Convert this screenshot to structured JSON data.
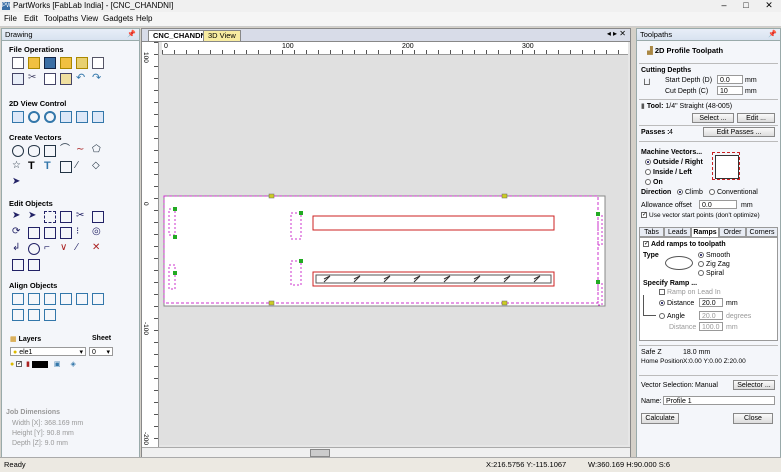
{
  "window": {
    "title": "PartWorks [FabLab India] - [CNC_CHANDNI]",
    "app_icon": "PW"
  },
  "menu": [
    "File",
    "Edit",
    "Toolpaths",
    "View",
    "Gadgets",
    "Help"
  ],
  "drawing_panel": {
    "title": "Drawing",
    "sections": {
      "file_ops": "File Operations",
      "view_control": "2D View Control",
      "create_vectors": "Create Vectors",
      "edit_objects": "Edit Objects",
      "align_objects": "Align Objects"
    },
    "layers": {
      "label": "Layers",
      "current": "ele1"
    },
    "sheet": {
      "label": "Sheet",
      "current": "0"
    },
    "job_dimensions": {
      "title": "Job Dimensions",
      "width": "Width  [X]: 368.169 mm",
      "height": "Height [Y]: 90.8 mm",
      "depth": "Depth  [Z]: 9.0 mm"
    }
  },
  "view": {
    "tabs": [
      "CNC_CHANDNI",
      "3D View"
    ],
    "ruler_h": [
      "0",
      "100",
      "200",
      "300"
    ],
    "ruler_v": [
      "100",
      "0",
      "-100",
      "-200"
    ]
  },
  "toolpaths_panel": {
    "title": "Toolpaths",
    "heading": "2D Profile Toolpath",
    "cutting_depths": {
      "title": "Cutting Depths",
      "start_label": "Start Depth (D)",
      "start_value": "0.0",
      "start_unit": "mm",
      "cut_label": "Cut Depth (C)",
      "cut_value": "10",
      "cut_unit": "mm"
    },
    "tool": {
      "label": "Tool:",
      "name": "1/4\" Straight  (48-005)",
      "select": "Select ...",
      "edit": "Edit ..."
    },
    "passes": {
      "label": "Passes :",
      "value": "4",
      "edit": "Edit Passes ..."
    },
    "machine_vectors": {
      "title": "Machine Vectors...",
      "outside": "Outside / Right",
      "inside": "Inside / Left",
      "on": "On",
      "direction": "Direction",
      "climb": "Climb",
      "conventional": "Conventional",
      "allowance_label": "Allowance offset",
      "allowance_value": "0.0",
      "allowance_unit": "mm",
      "use_start_points": "Use vector start points (don't optimize)"
    },
    "subtabs": [
      "Tabs",
      "Leads",
      "Ramps",
      "Order",
      "Corners"
    ],
    "ramps": {
      "add": "Add ramps to toolpath",
      "type": "Type",
      "smooth": "Smooth",
      "zigzag": "Zig Zag",
      "spiral": "Spiral",
      "specify": "Specify Ramp ...",
      "ramp_on_lead": "Ramp on Lead In",
      "distance": "Distance",
      "distance_value": "20.0",
      "distance_unit": "mm",
      "angle": "Angle",
      "angle_value": "20.0",
      "angle_unit": "degrees",
      "distance2": "Distance",
      "distance2_value": "100.0",
      "distance2_unit": "mm"
    },
    "safe_z": {
      "label": "Safe Z",
      "value": "18.0 mm"
    },
    "home": {
      "label": "Home Position",
      "value": "X:0.00 Y:0.00 Z:20.00"
    },
    "vector_selection": {
      "label": "Vector Selection:",
      "mode": "Manual",
      "button": "Selector ..."
    },
    "name": {
      "label": "Name:",
      "value": "Profile 1"
    },
    "calculate": "Calculate",
    "close": "Close"
  },
  "status": {
    "left": "Ready",
    "coords": "X:216.5756 Y:-115.1067",
    "dims": "W:360.169  H:90.000  S:6"
  },
  "colors": {
    "accent": "#3a6ea5",
    "vector_red": "#cc2222",
    "selection_magenta": "#cc33cc",
    "handle_green": "#22aa22",
    "handle_yellow": "#cccc22"
  }
}
